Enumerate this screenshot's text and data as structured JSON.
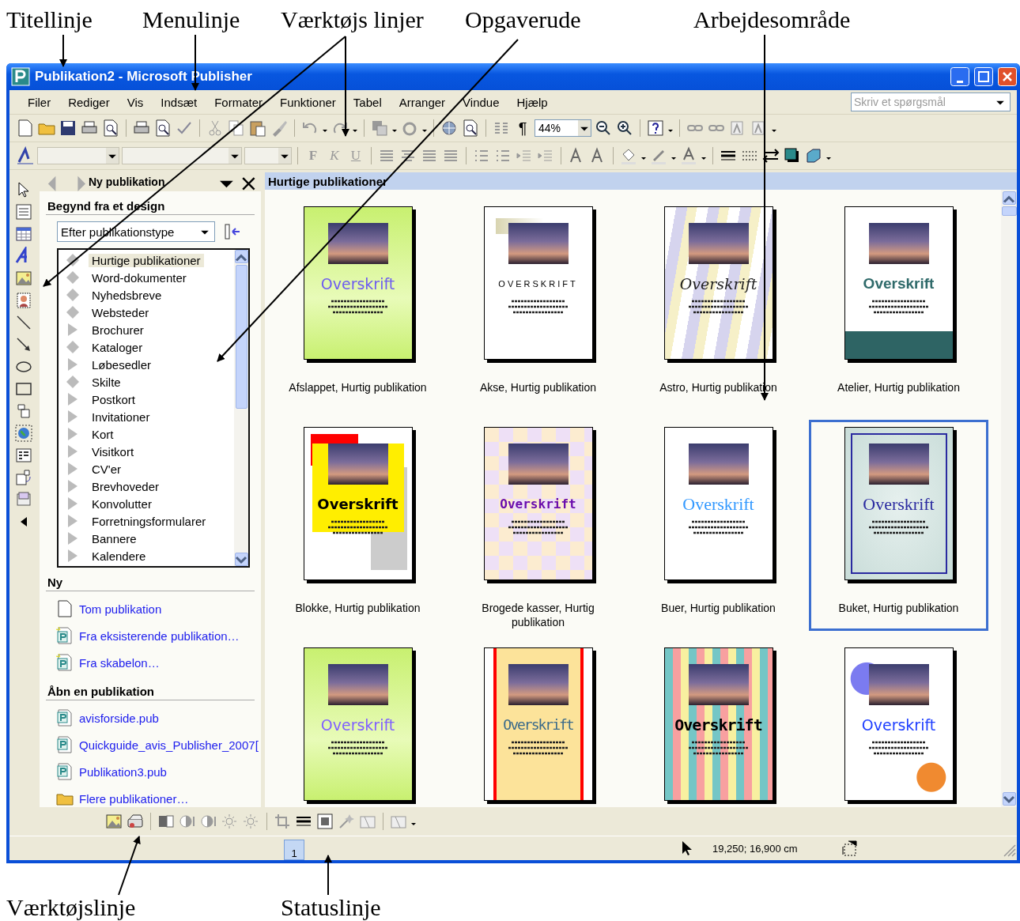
{
  "annotations": [
    "Titellinje",
    "Menulinje",
    "Værktøjs linjer",
    "Opgaverude",
    "Arbejdesområde",
    "Værktøjslinje",
    "Statuslinje"
  ],
  "window": {
    "title": "Publikation2 - Microsoft Publisher"
  },
  "menu": [
    "Filer",
    "Rediger",
    "Vis",
    "Indsæt",
    "Formater",
    "Funktioner",
    "Tabel",
    "Arranger",
    "Vindue",
    "Hjælp"
  ],
  "help_field": {
    "placeholder": "Skriv et spørgsmål"
  },
  "standard_toolbar": {
    "pilcrow": "¶",
    "zoom": "44%"
  },
  "formatting_toolbar": {
    "bold": "F",
    "italic": "K",
    "underline": "U"
  },
  "task_pane": {
    "title": "Ny publikation",
    "design_heading": "Begynd fra et design",
    "design_filter": "Efter publikationstype",
    "categories": [
      {
        "label": "Hurtige publikationer",
        "expandable": false,
        "selected": true
      },
      {
        "label": "Word-dokumenter",
        "expandable": false,
        "selected": false
      },
      {
        "label": "Nyhedsbreve",
        "expandable": false,
        "selected": false
      },
      {
        "label": "Websteder",
        "expandable": false,
        "selected": false
      },
      {
        "label": "Brochurer",
        "expandable": true,
        "selected": false
      },
      {
        "label": "Kataloger",
        "expandable": false,
        "selected": false
      },
      {
        "label": "Løbesedler",
        "expandable": true,
        "selected": false
      },
      {
        "label": "Skilte",
        "expandable": false,
        "selected": false
      },
      {
        "label": "Postkort",
        "expandable": true,
        "selected": false
      },
      {
        "label": "Invitationer",
        "expandable": true,
        "selected": false
      },
      {
        "label": "Kort",
        "expandable": true,
        "selected": false
      },
      {
        "label": "Visitkort",
        "expandable": true,
        "selected": false
      },
      {
        "label": "CV'er",
        "expandable": true,
        "selected": false
      },
      {
        "label": "Brevhoveder",
        "expandable": true,
        "selected": false
      },
      {
        "label": "Konvolutter",
        "expandable": true,
        "selected": false
      },
      {
        "label": "Forretningsformularer",
        "expandable": true,
        "selected": false
      },
      {
        "label": "Bannere",
        "expandable": true,
        "selected": false
      },
      {
        "label": "Kalendere",
        "expandable": true,
        "selected": false
      }
    ],
    "new_heading": "Ny",
    "new_links": [
      {
        "label": "Tom publikation",
        "kind": "blank"
      },
      {
        "label": "Fra eksisterende publikation…",
        "kind": "existing"
      },
      {
        "label": "Fra skabelon…",
        "kind": "existing"
      }
    ],
    "open_heading": "Åbn en publikation",
    "open_links": [
      {
        "label": "avisforside.pub",
        "kind": "file"
      },
      {
        "label": "Quickguide_avis_Publisher_2007[",
        "kind": "file"
      },
      {
        "label": "Publikation3.pub",
        "kind": "file"
      },
      {
        "label": "Flere publikationer…",
        "kind": "folder"
      }
    ]
  },
  "workspace": {
    "title": "Hurtige publikationer",
    "designs": [
      {
        "caption": "Afslappet, Hurtig publikation",
        "heading": "Overskrift",
        "kind": "wash",
        "color": "#6d5cf0",
        "selected": false
      },
      {
        "caption": "Akse, Hurtig publikation",
        "heading": "OVERSKRIFT",
        "kind": "bracket",
        "color": "#000000",
        "selected": false
      },
      {
        "caption": "Astro, Hurtig publikation",
        "heading": "Overskrift",
        "kind": "flowers",
        "color": "#222222",
        "selected": false
      },
      {
        "caption": "Atelier, Hurtig publikation",
        "heading": "Overskrift",
        "kind": "rounded",
        "color": "#2f6a6a",
        "selected": false
      },
      {
        "caption": "Blokke, Hurtig publikation",
        "heading": "Overskrift",
        "kind": "blocks",
        "color": "#000000",
        "selected": false
      },
      {
        "caption": "Brogede kasser, Hurtig publikation",
        "heading": "Overskrift",
        "kind": "checks",
        "color": "#6a0dad",
        "selected": false
      },
      {
        "caption": "Buer, Hurtig publikation",
        "heading": "Overskrift",
        "kind": "arcs",
        "color": "#3399ff",
        "selected": false
      },
      {
        "caption": "Buket, Hurtig publikation",
        "heading": "Overskrift",
        "kind": "bouquet",
        "color": "#2a2aa0",
        "selected": true
      },
      {
        "heading": "Overskrift",
        "kind": "wash",
        "color": "#8060ff",
        "selected": false
      },
      {
        "heading": "Overskrift",
        "kind": "stripes",
        "color": "#3a6a8a",
        "selected": false
      },
      {
        "heading": "Overskrift",
        "kind": "bars",
        "color": "#000000",
        "selected": false
      },
      {
        "heading": "Overskrift",
        "kind": "dots",
        "color": "#2040ff",
        "selected": false
      }
    ]
  },
  "status_bar": {
    "page": "1",
    "position": "19,250; 16,900 cm"
  }
}
